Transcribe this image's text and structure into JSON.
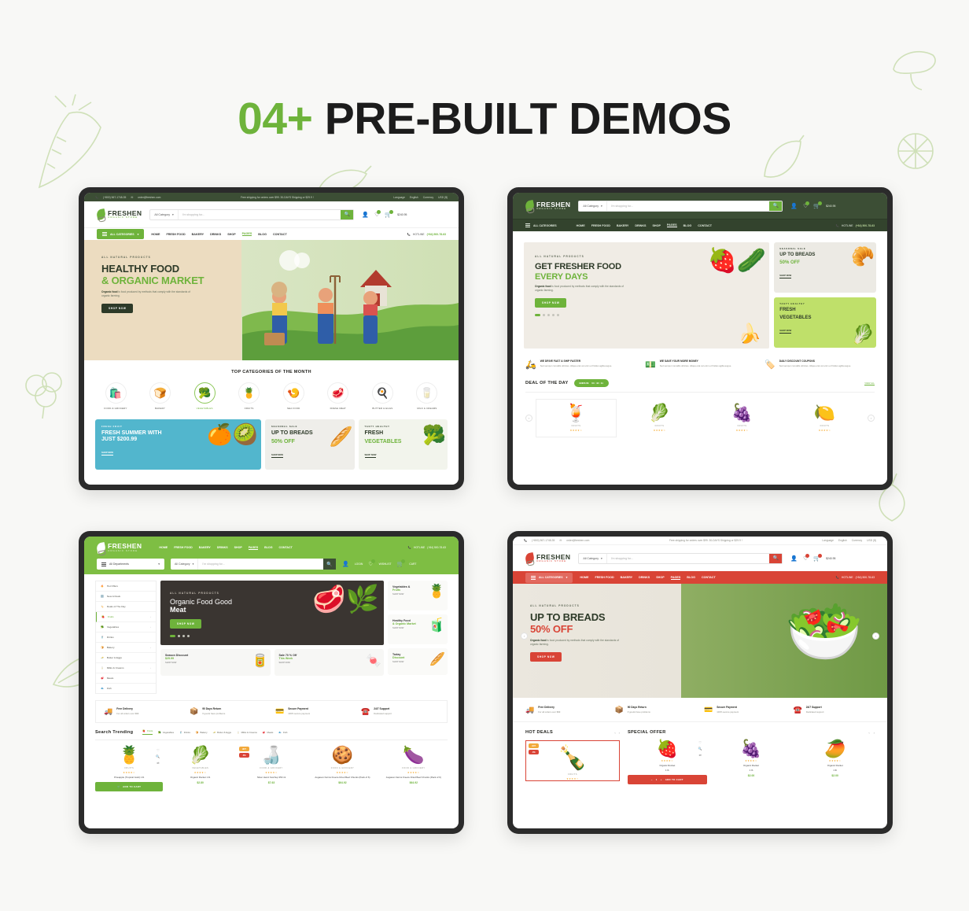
{
  "page": {
    "title_number": "04+",
    "title_text": "PRE-BUILT DEMOS",
    "accent_green": "#6eb33b",
    "accent_red": "#d94436",
    "background": "#f8f8f6"
  },
  "common": {
    "topbar": {
      "phone": "(+800) 567-1748-35",
      "email": "order@freshen.com",
      "promo": "Free shipping for orders over $99. 30-DAYS Shipping or $29.9 !",
      "language_label": "Language",
      "language_value": "English",
      "currency_label": "Currency",
      "currency_value": "USD ($)"
    },
    "logo": {
      "name": "FRESHEN",
      "tagline": "ORGANIC STORE"
    },
    "search": {
      "category": "All Category",
      "placeholder": "I'm shopping for...",
      "button_icon": "search-icon"
    },
    "account": {
      "login": "LOGIN",
      "wishlist": "WISHLIST",
      "cart": "$240.95",
      "cart_label": "CART"
    },
    "nav": {
      "all_categories": "ALL CATEGORIES",
      "items": [
        "HOME",
        "FRESH FOOD",
        "BAKERY",
        "DRINKS",
        "SHOP",
        "PAGES",
        "BLOG",
        "CONTACT"
      ],
      "active": "PAGES",
      "hotline_label": "HOTLINE",
      "hotline_number": "(+84) 500-78-63"
    }
  },
  "demo1": {
    "hero": {
      "eyebrow": "ALL NATURAL PRODUCTS",
      "line1": "HEALTHY FOOD",
      "line2": "& ORGANIC MARKET",
      "paragraph_bold": "Organic food",
      "paragraph": "is food produced by methods that comply with the standards of organic farming.",
      "button": "SHOP NOW"
    },
    "categories_title": "TOP CATEGORIES OF THE MONTH",
    "categories": [
      {
        "label": "FOOD & GROCERY",
        "icon": "🛍️",
        "active": false
      },
      {
        "label": "BAKERY",
        "icon": "🍞",
        "active": false
      },
      {
        "label": "VEGETABLES",
        "icon": "🥦",
        "active": true
      },
      {
        "label": "FRUITS",
        "icon": "🍍",
        "active": false
      },
      {
        "label": "SEA FOOD",
        "icon": "🍤",
        "active": false
      },
      {
        "label": "FRESH MEAT",
        "icon": "🥩",
        "active": false
      },
      {
        "label": "BUTTER & EGGS",
        "icon": "🍳",
        "active": false
      },
      {
        "label": "MILK & CREAMS",
        "icon": "🥛",
        "active": false
      }
    ],
    "promos": [
      {
        "eyebrow": "FRESH FRUIT",
        "title": "FRESH SUMMER WITH",
        "title2": "JUST $200.99",
        "link": "SHOP NOW",
        "bg": "#52b6cd",
        "color": "#ffffff"
      },
      {
        "eyebrow": "SEASONAL SALE",
        "title": "UP TO BREADS",
        "title2": "50% OFF",
        "link": "SHOP NOW",
        "bg": "#efeeea",
        "color": "#2d3a28"
      },
      {
        "eyebrow": "TASTY HEALTHY",
        "title": "FRESH",
        "title2": "VEGETABLES",
        "link": "SHOP NOW",
        "bg": "#f2f4ec",
        "color": "#2d3a28"
      }
    ]
  },
  "demo2": {
    "hero": {
      "eyebrow": "ALL NATURAL PRODUCTS",
      "line1": "GET FRESHER FOOD",
      "line2": "EVERY DAYS",
      "paragraph_bold": "Organic food",
      "paragraph": "is food produced by methods that comply with the standards of organic farming.",
      "button": "SHOP NOW"
    },
    "side_banners": [
      {
        "eyebrow": "SEASONAL SALE",
        "title": "UP TO BREADS",
        "title2": "50% OFF",
        "link": "SHOP NOW",
        "bg": "#eceae4"
      },
      {
        "eyebrow": "TASTY HEALTHY",
        "title": "FRESH",
        "title2": "VEGETABLES",
        "link": "SHOP NOW",
        "bg": "#bfe06a"
      }
    ],
    "features": [
      {
        "icon": "🛵",
        "title": "WE DRIVE FAST & SHIP FASTER",
        "sub": "Sed semper convallis ultricies. Aliqua erat vel enim et fristles agilla augue."
      },
      {
        "icon": "💵",
        "title": "WE SAVE YOUR MORE MONEY",
        "sub": "Sed semper convallis ultricies. Aliqua erat vel enim et fristles agilla augue."
      },
      {
        "icon": "🏷️",
        "title": "DAILY DISCOUNT COUPONS",
        "sub": "Sed semper convallis ultricies. Aliqua erat vel enim et fristles agilla augue."
      }
    ],
    "deal": {
      "title": "DEAL OF THE DAY",
      "ends_label": "ENDS IN:",
      "ends_time": "04 : 43 : 11",
      "view_all": "VIEW ALL"
    },
    "deal_products": [
      {
        "icon": "🍹",
        "cat": "FRUITS",
        "stars": "★★★★☆"
      },
      {
        "icon": "🥬",
        "cat": "FRUITS",
        "stars": "★★★★☆"
      },
      {
        "icon": "🍇",
        "cat": "FRUITS",
        "stars": "★★★★☆"
      },
      {
        "icon": "🍋",
        "cat": "FRUITS",
        "stars": "★★★★☆"
      }
    ]
  },
  "demo3": {
    "departments_label": "All Departments",
    "sidebar": [
      {
        "label": "Hot Offers",
        "icon": "🔥",
        "arrow": false,
        "active": false
      },
      {
        "label": "New Arrivals",
        "icon": "🆕",
        "arrow": false,
        "active": false
      },
      {
        "label": "Deals of The Day",
        "icon": "🏷️",
        "arrow": false,
        "active": false
      },
      {
        "label": "Fruits",
        "icon": "🍓",
        "arrow": true,
        "active": true
      },
      {
        "label": "Vegetables",
        "icon": "🥦",
        "arrow": true,
        "active": false
      },
      {
        "label": "Drinks",
        "icon": "🥤",
        "arrow": false,
        "active": false
      },
      {
        "label": "Bakery",
        "icon": "🍞",
        "arrow": true,
        "active": false
      },
      {
        "label": "Butter & Eggs",
        "icon": "🧈",
        "arrow": false,
        "active": false
      },
      {
        "label": "Milks & Creams",
        "icon": "🥛",
        "arrow": true,
        "active": false
      },
      {
        "label": "Meats",
        "icon": "🥩",
        "arrow": false,
        "active": false
      },
      {
        "label": "Fish",
        "icon": "🐟",
        "arrow": false,
        "active": false
      }
    ],
    "hero": {
      "eyebrow": "ALL NATURAL PRODUCTS",
      "line1": "Organic Food Good",
      "line2": "Meat",
      "button": "SHOP NOW"
    },
    "side_cards": [
      {
        "title": "Vegetables &",
        "title2": "Fruits",
        "link": "SHOP NOW",
        "icon": "🍍"
      },
      {
        "title": "Healthy Food",
        "title2": "& Organic Market",
        "link": "SHOP NOW",
        "icon": "🧃"
      }
    ],
    "small_cards": [
      {
        "title": "Season Discount",
        "value": "$25.99",
        "link": "SHOP NOW",
        "icon": "🥫"
      },
      {
        "title": "Sale 70 % Off",
        "value": "This Week",
        "link": "SHOP NOW",
        "icon": "🍬"
      },
      {
        "title": "Today",
        "value": "Discount",
        "link": "SHOP NOW",
        "icon": "🥖"
      }
    ],
    "services": [
      {
        "icon": "🚚",
        "title": "Free Delivery",
        "sub": "For all orders over $99"
      },
      {
        "icon": "📦",
        "title": "90 Days Return",
        "sub": "If goods have problems"
      },
      {
        "icon": "💳",
        "title": "Secure Payment",
        "sub": "100% secure payment"
      },
      {
        "icon": "☎️",
        "title": "24/7 Support",
        "sub": "Dedicated support"
      }
    ],
    "trending_title": "Search Trending",
    "chips": [
      {
        "label": "Fruits",
        "icon": "🍓",
        "active": true
      },
      {
        "label": "Vegetables",
        "icon": "🥦",
        "active": false
      },
      {
        "label": "Drinks",
        "icon": "🥤",
        "active": false
      },
      {
        "label": "Bakery",
        "icon": "🍞",
        "active": false
      },
      {
        "label": "Butter & Eggs",
        "icon": "🧈",
        "active": false
      },
      {
        "label": "Milks & Creams",
        "icon": "🥛",
        "active": false
      },
      {
        "label": "Meats",
        "icon": "🥩",
        "active": false
      },
      {
        "label": "Fish",
        "icon": "🐟",
        "active": false
      }
    ],
    "products": [
      {
        "icon": "🍍",
        "cat": "FRUITS",
        "stars": "★★★★☆",
        "name": "Pineapple (Tropical Gold) 1 lb",
        "price": "",
        "button": "ADD TO CART",
        "tags": []
      },
      {
        "icon": "🥬",
        "cat": "VEGETABLES",
        "stars": "★★★★☆",
        "name": "Organic Rocket 1 lb",
        "price": "$2.80",
        "button": "",
        "tags": []
      },
      {
        "icon": "🍶",
        "cat": "FOOD & GROCERY",
        "stars": "★★★★☆",
        "name": "Silver Heinz Ketchup 350 ml",
        "price": "$7.63",
        "button": "",
        "tags": [
          "HOT",
          "-8%"
        ]
      },
      {
        "icon": "🍪",
        "cat": "FOOD & GROCERY",
        "stars": "★★★★☆",
        "name": "Augason Farms Freeze Dried Beef Chunks (Pack of 6)",
        "price": "$64.92",
        "button": "",
        "tags": []
      },
      {
        "icon": "🍆",
        "cat": "FOOD & GROCERY",
        "stars": "★★★★☆",
        "name": "Augason Farms Freeze Dried Beef Chunks (Pack of 6)",
        "price": "$64.92",
        "button": "",
        "tags": []
      }
    ],
    "cart_add_label": "ADD TO CART"
  },
  "demo4": {
    "hero": {
      "eyebrow": "ALL NATURAL PRODUCTS",
      "line1": "UP TO BREADS",
      "line2": "50% OFF",
      "paragraph_bold": "Organic food",
      "paragraph": "is food produced by methods that comply with the standards of organic farming.",
      "button": "SHOP NOW"
    },
    "services": [
      {
        "icon": "🚚",
        "title": "Free Delivery",
        "sub": "For all orders over $99"
      },
      {
        "icon": "📦",
        "title": "90 Days Return",
        "sub": "If goods have problems"
      },
      {
        "icon": "💳",
        "title": "Secure Payment",
        "sub": "100% secure payment"
      },
      {
        "icon": "☎️",
        "title": "24/7 Support",
        "sub": "Dedicated support"
      }
    ],
    "hot_deals": {
      "title": "HOT DEALS",
      "product": {
        "icon": "🍾",
        "cat": "FRUITS",
        "stars": "★★★★☆",
        "tags": [
          "HOT",
          "-8%"
        ]
      },
      "quantity": "1",
      "button": "ADD TO CART"
    },
    "special_offer": {
      "title": "SPECIAL OFFER",
      "products": [
        {
          "icon": "🍓",
          "stars": "★★★★☆",
          "name": "Organic Rocket",
          "unit": "1 lb",
          "price": ""
        },
        {
          "icon": "🍇",
          "stars": "★★★★☆",
          "name": "Organic Rocket",
          "unit": "1 lb",
          "price": "$2.00"
        },
        {
          "icon": "🥭",
          "stars": "★★★★☆",
          "name": "Organic Rocket",
          "unit": "1 lb",
          "price": "$2.00"
        }
      ]
    }
  }
}
